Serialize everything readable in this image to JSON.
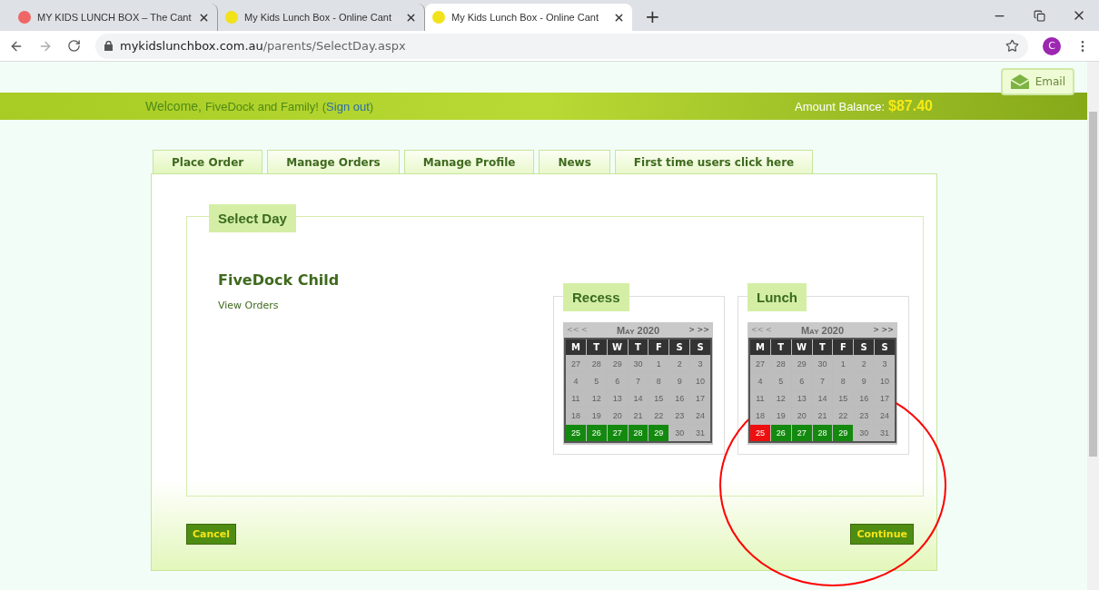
{
  "browser": {
    "tabs": [
      {
        "title": "MY KIDS LUNCH BOX – The Cant",
        "selected": false
      },
      {
        "title": "My Kids Lunch Box - Online Cant",
        "selected": false
      },
      {
        "title": "My Kids Lunch Box - Online Cant",
        "selected": true
      }
    ],
    "new_tab": "+",
    "url_host": "mykidslunchbox.com.au",
    "url_path": "/parents/SelectDay.aspx",
    "profile": "C"
  },
  "email_button": "Email",
  "banner": {
    "welcome": "Welcome,",
    "family": "FiveDock and Family!",
    "sign_out_open": "(",
    "sign_out": "Sign out",
    "sign_out_close": ")",
    "balance_label": "Amount Balance:",
    "balance": "$87.40"
  },
  "nav_tabs": [
    {
      "label": "Place Order",
      "selected": true
    },
    {
      "label": "Manage Orders",
      "selected": false
    },
    {
      "label": "Manage Profile",
      "selected": false
    },
    {
      "label": "News",
      "selected": false
    },
    {
      "label": "First time users click here",
      "selected": false
    }
  ],
  "section_title": "Select Day",
  "child": {
    "name": "FiveDock Child",
    "link": "View Orders"
  },
  "calendars": [
    {
      "title": "Recess",
      "prev": "<< <",
      "month": "May 2020",
      "next": "> >>",
      "weekdays": [
        "M",
        "T",
        "W",
        "T",
        "F",
        "S",
        "S"
      ],
      "weeks": [
        [
          {
            "day": "27",
            "kind": "closed"
          },
          {
            "day": "28",
            "kind": "closed"
          },
          {
            "day": "29",
            "kind": "closed"
          },
          {
            "day": "30",
            "kind": "closed"
          },
          {
            "day": "1",
            "kind": "closed"
          },
          {
            "day": "2",
            "kind": "closed"
          },
          {
            "day": "3",
            "kind": "closed"
          }
        ],
        [
          {
            "day": "4",
            "kind": "closed"
          },
          {
            "day": "5",
            "kind": "closed"
          },
          {
            "day": "6",
            "kind": "closed"
          },
          {
            "day": "7",
            "kind": "closed"
          },
          {
            "day": "8",
            "kind": "closed"
          },
          {
            "day": "9",
            "kind": "closed"
          },
          {
            "day": "10",
            "kind": "closed"
          }
        ],
        [
          {
            "day": "11",
            "kind": "closed"
          },
          {
            "day": "12",
            "kind": "closed"
          },
          {
            "day": "13",
            "kind": "closed"
          },
          {
            "day": "14",
            "kind": "closed"
          },
          {
            "day": "15",
            "kind": "closed"
          },
          {
            "day": "16",
            "kind": "closed"
          },
          {
            "day": "17",
            "kind": "closed"
          }
        ],
        [
          {
            "day": "18",
            "kind": "closed"
          },
          {
            "day": "19",
            "kind": "closed"
          },
          {
            "day": "20",
            "kind": "closed"
          },
          {
            "day": "21",
            "kind": "closed"
          },
          {
            "day": "22",
            "kind": "closed"
          },
          {
            "day": "23",
            "kind": "closed"
          },
          {
            "day": "24",
            "kind": "closed"
          }
        ],
        [
          {
            "day": "25",
            "kind": "open"
          },
          {
            "day": "26",
            "kind": "open"
          },
          {
            "day": "27",
            "kind": "open"
          },
          {
            "day": "28",
            "kind": "open"
          },
          {
            "day": "29",
            "kind": "open"
          },
          {
            "day": "30",
            "kind": "closed"
          },
          {
            "day": "31",
            "kind": "closed"
          }
        ]
      ]
    },
    {
      "title": "Lunch",
      "prev": "<< <",
      "month": "May 2020",
      "next": "> >>",
      "weekdays": [
        "M",
        "T",
        "W",
        "T",
        "F",
        "S",
        "S"
      ],
      "weeks": [
        [
          {
            "day": "27",
            "kind": "closed"
          },
          {
            "day": "28",
            "kind": "closed"
          },
          {
            "day": "29",
            "kind": "closed"
          },
          {
            "day": "30",
            "kind": "closed"
          },
          {
            "day": "1",
            "kind": "closed"
          },
          {
            "day": "2",
            "kind": "closed"
          },
          {
            "day": "3",
            "kind": "closed"
          }
        ],
        [
          {
            "day": "4",
            "kind": "closed"
          },
          {
            "day": "5",
            "kind": "closed"
          },
          {
            "day": "6",
            "kind": "closed"
          },
          {
            "day": "7",
            "kind": "closed"
          },
          {
            "day": "8",
            "kind": "closed"
          },
          {
            "day": "9",
            "kind": "closed"
          },
          {
            "day": "10",
            "kind": "closed"
          }
        ],
        [
          {
            "day": "11",
            "kind": "closed"
          },
          {
            "day": "12",
            "kind": "closed"
          },
          {
            "day": "13",
            "kind": "closed"
          },
          {
            "day": "14",
            "kind": "closed"
          },
          {
            "day": "15",
            "kind": "closed"
          },
          {
            "day": "16",
            "kind": "closed"
          },
          {
            "day": "17",
            "kind": "closed"
          }
        ],
        [
          {
            "day": "18",
            "kind": "closed"
          },
          {
            "day": "19",
            "kind": "closed"
          },
          {
            "day": "20",
            "kind": "closed"
          },
          {
            "day": "21",
            "kind": "closed"
          },
          {
            "day": "22",
            "kind": "closed"
          },
          {
            "day": "23",
            "kind": "closed"
          },
          {
            "day": "24",
            "kind": "closed"
          }
        ],
        [
          {
            "day": "25",
            "kind": "chosen"
          },
          {
            "day": "26",
            "kind": "open"
          },
          {
            "day": "27",
            "kind": "open"
          },
          {
            "day": "28",
            "kind": "open"
          },
          {
            "day": "29",
            "kind": "open"
          },
          {
            "day": "30",
            "kind": "closed"
          },
          {
            "day": "31",
            "kind": "closed"
          }
        ]
      ]
    }
  ],
  "buttons": {
    "cancel": "Cancel",
    "continue": "Continue"
  }
}
